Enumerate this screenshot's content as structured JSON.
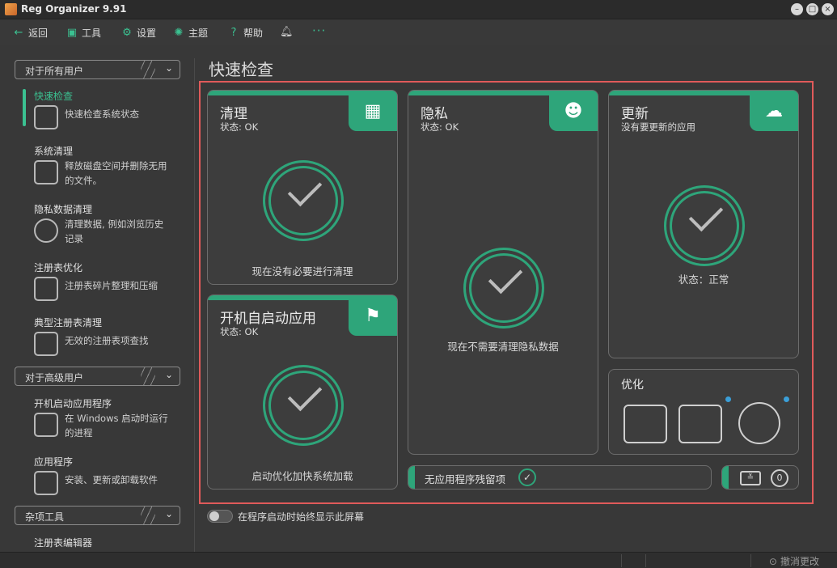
{
  "window": {
    "title": "Reg Organizer 9.91"
  },
  "toolbar": {
    "back": "返回",
    "tools": "工具",
    "settings": "设置",
    "theme": "主题",
    "help": "帮助",
    "more": "···"
  },
  "sidebar": {
    "group_all_users": "对于所有用户",
    "group_advanced": "对于高级用户",
    "group_misc": "杂项工具",
    "items": [
      {
        "title": "快速检查",
        "desc": "快速检查系统状态"
      },
      {
        "title": "系统清理",
        "desc": "释放磁盘空间并删除无用的文件。"
      },
      {
        "title": "隐私数据清理",
        "desc": "清理数据, 例如浏览历史记录"
      },
      {
        "title": "注册表优化",
        "desc": "注册表碎片整理和压缩"
      },
      {
        "title": "典型注册表清理",
        "desc": "无效的注册表项查找"
      },
      {
        "title": "开机启动应用程序",
        "desc": "在 Windows 启动时运行的进程"
      },
      {
        "title": "应用程序",
        "desc": "安装、更新或卸载软件"
      },
      {
        "title": "注册表编辑器",
        "desc": ""
      }
    ]
  },
  "main": {
    "title": "快速检查",
    "cards": {
      "clean": {
        "title": "清理",
        "status": "状态: OK",
        "message": "现在没有必要进行清理"
      },
      "startup": {
        "title": "开机自启动应用",
        "status": "状态: OK",
        "message": "启动优化加快系统加载"
      },
      "privacy": {
        "title": "隐私",
        "status": "状态: OK",
        "message": "现在不需要清理隐私数据"
      },
      "update": {
        "title": "更新",
        "status": "没有要更新的应用",
        "message": "状态：正常"
      },
      "optimize": {
        "title": "优化"
      }
    },
    "leftovers": "无应用程序残留项",
    "counter": "0",
    "toggle_label": "在程序启动时始终显示此屏幕"
  },
  "statusbar": {
    "undo": "撤消更改"
  },
  "colors": {
    "accent": "#2ea57a",
    "frame": "#e05a5a",
    "background": "#383838"
  }
}
